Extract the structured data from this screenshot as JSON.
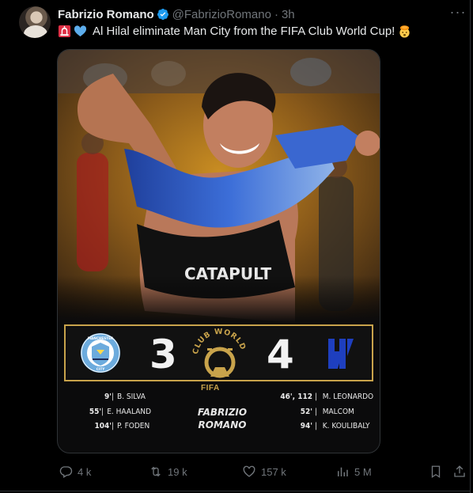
{
  "author": {
    "name": "Fabrizio Romano",
    "handle": "@FabrizioRomano",
    "separator": "·",
    "time": "3h",
    "verified": true
  },
  "tweet": {
    "emojis": [
      "siren-icon",
      "blue-heart-icon"
    ],
    "text": "Al Hilal eliminate Man City from the FIFA Club World Cup!",
    "trailing_emoji": "exploding-head-icon"
  },
  "graphic": {
    "home_score": "3",
    "away_score": "4",
    "home_club_badge_text": [
      "MANCHESTER",
      "CITY"
    ],
    "sponsor_text": "CATAPULT",
    "tournament_logo_text": "CLUB WORLD CUP 25",
    "fifa_label": "FIFA",
    "home_scorers": [
      {
        "minute": "9'",
        "player": "B. SILVA"
      },
      {
        "minute": "55'",
        "player": "E. HAALAND"
      },
      {
        "minute": "104'",
        "player": "P. FODEN"
      }
    ],
    "away_scorers": [
      {
        "minute": "46', 112",
        "player": "M. LEONARDO"
      },
      {
        "minute": "52'",
        "player": "MALCOM"
      },
      {
        "minute": "94'",
        "player": "K. KOULIBALY"
      }
    ],
    "watermark_lines": [
      "FABRIZIO",
      "ROMANO"
    ]
  },
  "actions": {
    "replies": "4 k",
    "reposts": "19 k",
    "likes": "157 k",
    "views": "5 M"
  },
  "colors": {
    "background": "#000000",
    "text_primary": "#e7e9ea",
    "text_secondary": "#71767b",
    "verified_blue": "#1d9bf0",
    "gold": "#c8a34b",
    "city_blue": "#6cabdd",
    "hilal_blue": "#1e3fbf"
  }
}
